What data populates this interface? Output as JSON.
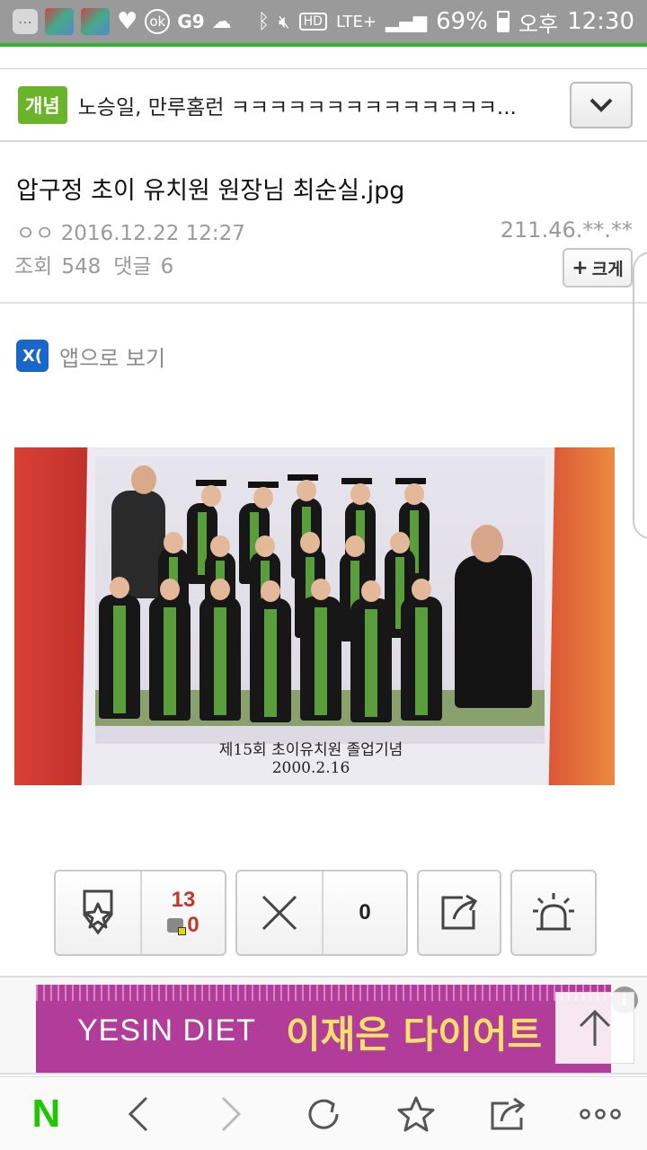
{
  "status_bar": {
    "battery_percent": "69%",
    "ampm": "오후",
    "time": "12:30",
    "network": "LTE+",
    "hd": "HD"
  },
  "notice": {
    "badge": "개념",
    "text": "노승일, 만루홈런 ㅋㅋㅋㅋㅋㅋㅋㅋㅋㅋㅋㅋㅋㅋ..."
  },
  "post": {
    "title": "압구정 초이 유치원 원장님 최순실.jpg",
    "author": "ㅇㅇ",
    "datetime": "2016.12.22 12:27",
    "ip": "211.46.**.**",
    "views_label": "조회",
    "views": "548",
    "comments_label": "댓글",
    "comments": "6",
    "bigger_label": "크게"
  },
  "app_view": {
    "label": "앱으로 보기"
  },
  "photo": {
    "caption_line1": "제15회 초이유치원 졸업기념",
    "caption_line2": "2000.2.16"
  },
  "reactions": {
    "recommend_count": "13",
    "recommend_fixed": "0",
    "dislike_count": "0"
  },
  "ad": {
    "brand": "YESIN DIET",
    "slogan": "이재은 다이어트"
  },
  "colors": {
    "accent_green": "#31b32d",
    "badge_green": "#6ab42a",
    "naver_green": "#1ec800",
    "ad_purple": "#b13c9a",
    "ad_yellow": "#fbe06a",
    "count_red": "#c0392b"
  }
}
